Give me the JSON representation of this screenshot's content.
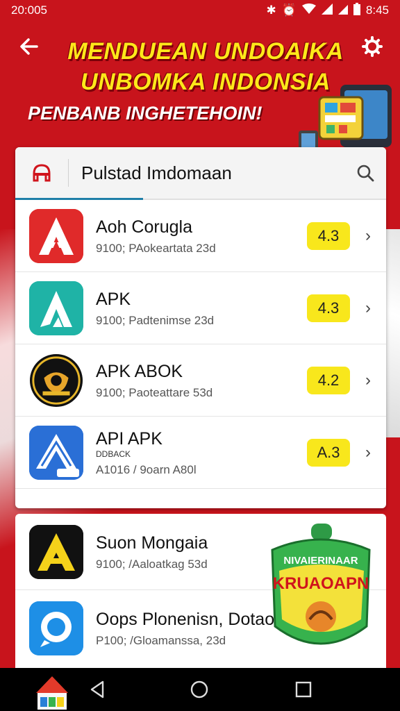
{
  "status_bar": {
    "time": "20:005",
    "right_time": "8:45"
  },
  "header": {
    "title_line1": "MENDUEAN UNDOAIKA",
    "title_line2": "UNBOMKA INDONSIA",
    "subtitle": "PENBANB INGHETEHOIN!"
  },
  "search": {
    "query": "Pulstad Imdomaan"
  },
  "apps": [
    {
      "name": "Aoh Corugla",
      "sub_name": "",
      "meta": "9100; PAokeartata 23d",
      "rating": "4.3"
    },
    {
      "name": "APK",
      "sub_name": "",
      "meta": "9100; Padtenimse 23d",
      "rating": "4.3"
    },
    {
      "name": "APK ABOK",
      "sub_name": "",
      "meta": "9100; Paoteattare 53d",
      "rating": "4.2"
    },
    {
      "name": "API APK",
      "sub_name": "DDBACK",
      "meta": "A1016 / 9oarn A80l",
      "rating": "A.3"
    }
  ],
  "apps_more": [
    {
      "name": "Suon Mongaia",
      "meta": "9100; /Aaloatkag 53d"
    },
    {
      "name": "Oops Plonenisn, Dotaola.",
      "meta": "P100; /Gloamanssa, 23d"
    }
  ],
  "promo": {
    "line1": "NIVAIERINAAR",
    "line2": "KRUAOAPN"
  },
  "colors": {
    "primary": "#c8141c",
    "accent_yellow": "#f8e71c",
    "tab_underline": "#1f7fa8"
  }
}
